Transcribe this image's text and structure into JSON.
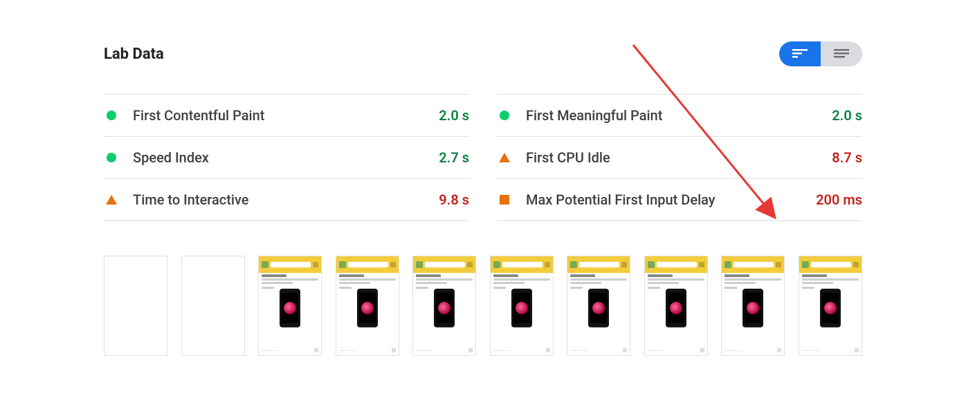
{
  "section_title": "Lab Data",
  "metrics": {
    "left": [
      {
        "status": "green",
        "label": "First Contentful Paint",
        "value": "2.0 s",
        "val_class": "v-green"
      },
      {
        "status": "green",
        "label": "Speed Index",
        "value": "2.7 s",
        "val_class": "v-green"
      },
      {
        "status": "triangle",
        "label": "Time to Interactive",
        "value": "9.8 s",
        "val_class": "v-orange"
      }
    ],
    "right": [
      {
        "status": "green",
        "label": "First Meaningful Paint",
        "value": "2.0 s",
        "val_class": "v-green"
      },
      {
        "status": "triangle",
        "label": "First CPU Idle",
        "value": "8.7 s",
        "val_class": "v-orange"
      },
      {
        "status": "square",
        "label": "Max Potential First Input Delay",
        "value": "200 ms",
        "val_class": "v-orange"
      }
    ]
  },
  "filmstrip_frames": 10,
  "blank_frames": 2
}
